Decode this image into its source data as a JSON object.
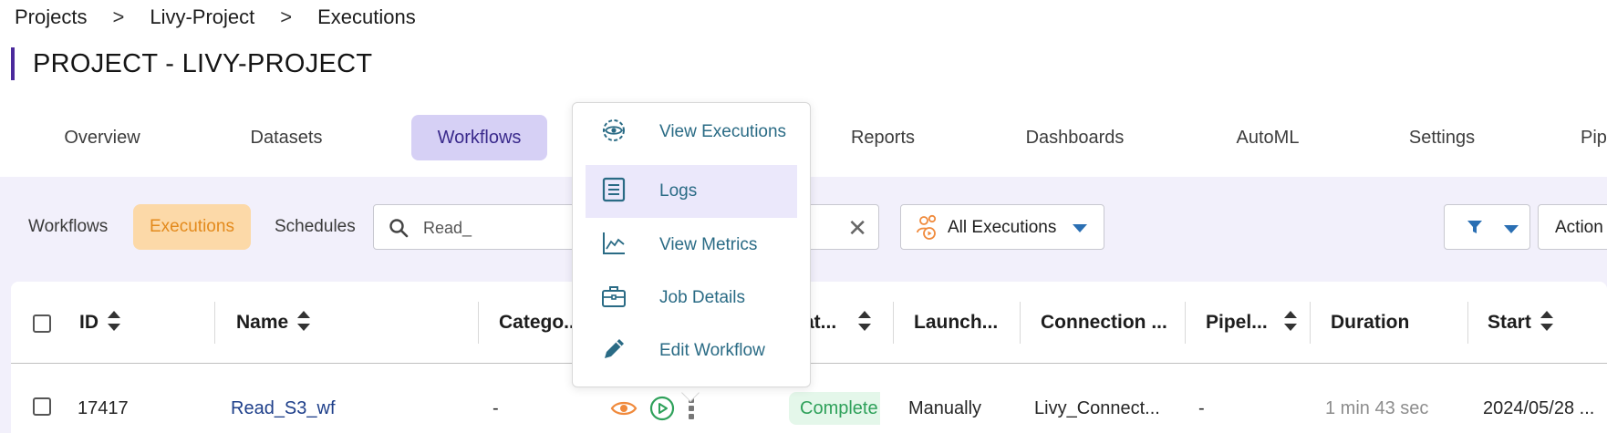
{
  "breadcrumb": {
    "items": [
      "Projects",
      "Livy-Project",
      "Executions"
    ],
    "separator": ">"
  },
  "page_title": "PROJECT - LIVY-PROJECT",
  "tabs": [
    "Overview",
    "Datasets",
    "Workflows",
    "Reports",
    "Dashboards",
    "AutoML",
    "Settings",
    "Pip"
  ],
  "active_tab": "Workflows",
  "subtabs": [
    "Workflows",
    "Executions",
    "Schedules"
  ],
  "active_subtab": "Executions",
  "search": {
    "value": "Read_"
  },
  "executions_filter": {
    "selected": "All Executions"
  },
  "actions_label": "Action",
  "table": {
    "columns": [
      "ID",
      "Name",
      "Catego...",
      "Stat...",
      "Launch...",
      "Connection ...",
      "Pipel...",
      "Duration",
      "Start"
    ],
    "rows": [
      {
        "id": "17417",
        "name": "Read_S3_wf",
        "category": "-",
        "status": "Complete",
        "launched": "Manually",
        "connection": "Livy_Connect...",
        "pipeline": "-",
        "duration": "1 min 43 sec",
        "start": "2024/05/28 ..."
      }
    ]
  },
  "row_menu": {
    "items": [
      {
        "label": "View Executions",
        "icon": "eye-gear-icon"
      },
      {
        "label": "Logs",
        "icon": "logs-icon"
      },
      {
        "label": "View Metrics",
        "icon": "metrics-chart-icon"
      },
      {
        "label": "Job Details",
        "icon": "briefcase-icon"
      },
      {
        "label": "Edit Workflow",
        "icon": "pencil-icon"
      }
    ],
    "highlighted": "Logs"
  },
  "colors": {
    "accent": "#4b2a9c",
    "active_tab_bg": "#d6d0f5",
    "active_subtab_bg": "#fcd9a8",
    "link": "#2a6b85",
    "status_complete": "#2ea15a"
  }
}
